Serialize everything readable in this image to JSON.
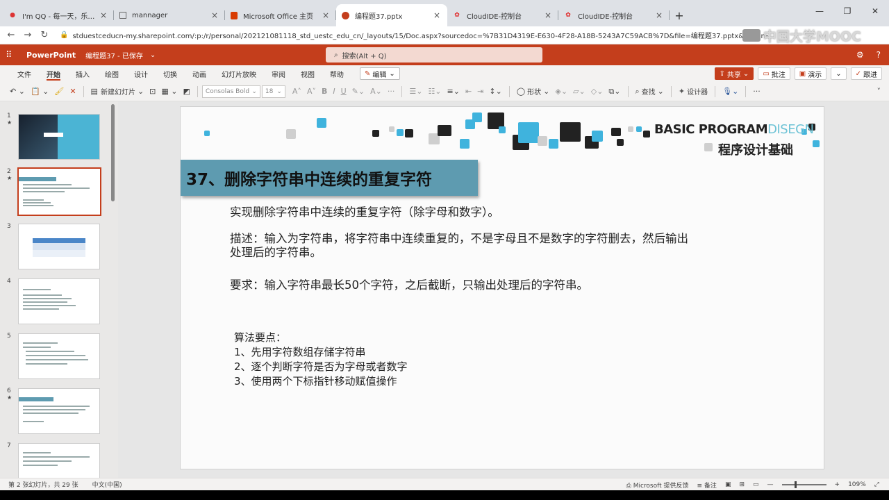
{
  "browser": {
    "tabs": [
      {
        "title": "I'm QQ - 每一天，乐在沟通",
        "icon": "qq-icon",
        "color": "#d33"
      },
      {
        "title": "mannager",
        "icon": "page-icon",
        "color": "#555"
      },
      {
        "title": "Microsoft Office 主页",
        "icon": "office-icon",
        "color": "#d83b01"
      },
      {
        "title": "编程题37.pptx",
        "icon": "powerpoint-icon",
        "color": "#c43e1c"
      },
      {
        "title": "CloudIDE-控制台",
        "icon": "huawei-icon",
        "color": "#e02020"
      },
      {
        "title": "CloudIDE-控制台",
        "icon": "huawei-icon",
        "color": "#e02020"
      }
    ],
    "new_tab": "+",
    "url": "stduestceducn-my.sharepoint.com/:p:/r/personal/202121081118_std_uestc_edu_cn/_layouts/15/Doc.aspx?sourcedoc=%7B31D4319E-E630-4F28-A18B-5243A7C59ACB%7D&file=编程题37.pptx&action=edit&mobileredirect=true&wdo...",
    "watermark": "中国大学MOOC"
  },
  "app": {
    "name": "PowerPoint",
    "doc_title": "编程题37 - 已保存",
    "search_placeholder": "搜索(Alt + Q)"
  },
  "ribbon": {
    "tabs": [
      "文件",
      "开始",
      "插入",
      "绘图",
      "设计",
      "切换",
      "动画",
      "幻灯片放映",
      "审阅",
      "视图",
      "帮助"
    ],
    "active_tab": "开始",
    "edit_mode": "编辑",
    "right_buttons": {
      "share": "共享",
      "comments": "批注",
      "present": "演示",
      "catchup": "跟进"
    }
  },
  "toolbar": {
    "new_slide": "新建幻灯片",
    "font_name": "Consolas Bold",
    "font_size": "18",
    "shapes": "形状",
    "find": "查找",
    "designer": "设计器"
  },
  "thumbnails": [
    {
      "num": "1",
      "star": "★"
    },
    {
      "num": "2",
      "star": "★"
    },
    {
      "num": "3",
      "star": ""
    },
    {
      "num": "4",
      "star": ""
    },
    {
      "num": "5",
      "star": ""
    },
    {
      "num": "6",
      "star": "★"
    },
    {
      "num": "7",
      "star": ""
    }
  ],
  "slide": {
    "brand_bold": "BASIC PROGRAM",
    "brand_light": "DISEGN",
    "brand_cn": "程序设计基础",
    "title": "37、删除字符串中连续的重复字符",
    "line1": "实现删除字符串中连续的重复字符（除字母和数字）。",
    "desc1": "描述：输入为字符串，将字符串中连续重复的，不是字母且不是数字的字符删去，然后输出",
    "desc2": "处理后的字符串。",
    "req": "要求：输入字符串最长50个字符，之后截断，只输出处理后的字符串。",
    "algo_title": "算法要点：",
    "algo1": "1、先用字符数组存储字符串",
    "algo2": "2、逐个判断字符是否为字母或者数字",
    "algo3": "3、使用两个下标指针移动赋值操作"
  },
  "status": {
    "slide_count": "第 2 张幻灯片，共 29 张",
    "language": "中文(中国)",
    "feedback": "Microsoft 提供反馈",
    "notes": "备注",
    "zoom": "109%"
  }
}
